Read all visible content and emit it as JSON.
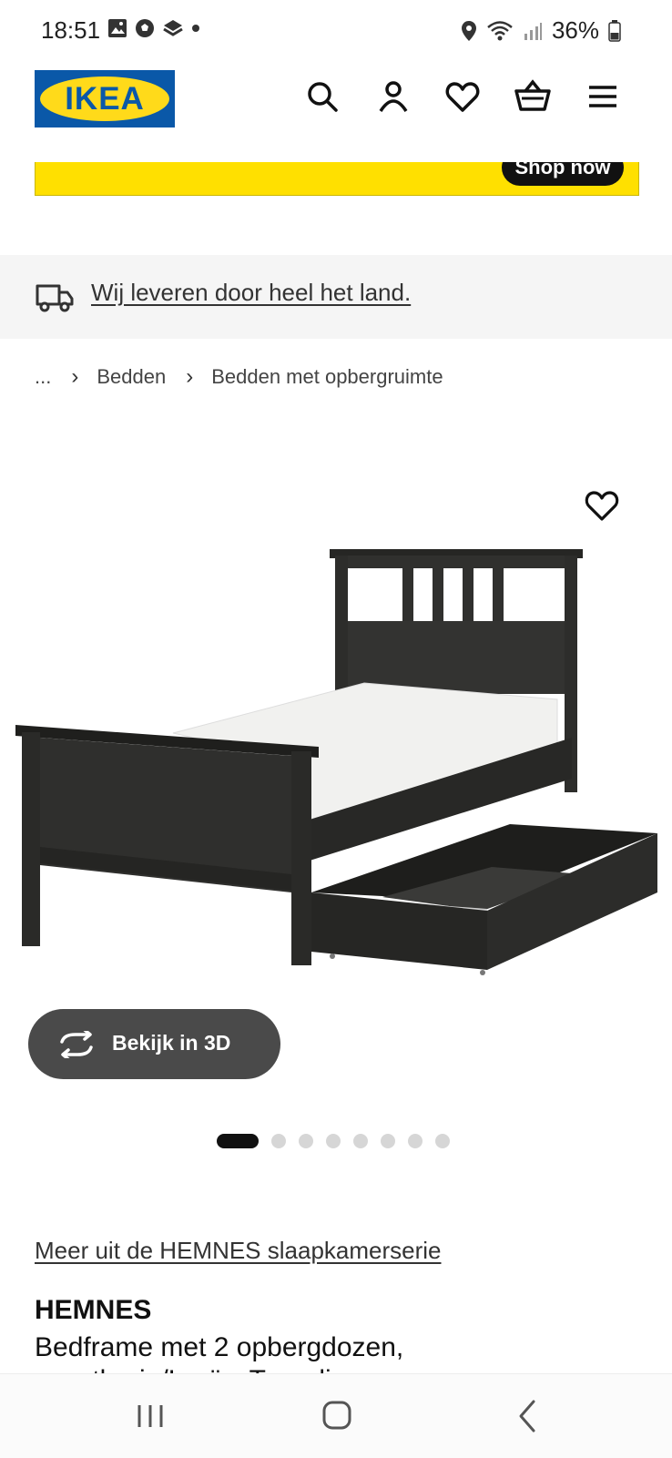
{
  "status_bar": {
    "time": "18:51",
    "battery": "36%"
  },
  "header": {
    "logo_text": "IKEA"
  },
  "banner": {
    "button_label": "Shop now"
  },
  "delivery": {
    "text": "Wij leveren door heel het land."
  },
  "breadcrumb": {
    "ellipsis": "...",
    "items": [
      "Bedden",
      "Bedden met opbergruimte"
    ]
  },
  "product": {
    "view_3d_label": "Bekijk in 3D",
    "image_count": 8,
    "active_image": 1,
    "series_link": "Meer uit de HEMNES slaapkamerserie",
    "name": "HEMNES",
    "description": "Bedframe met 2 opbergdozen,",
    "description_cut": "zwartbruin/Luröy, Tvorplin..."
  },
  "colors": {
    "ikea_blue": "#0a58a8",
    "ikea_yellow": "#ffda1a",
    "banner_yellow": "#ffe000"
  }
}
